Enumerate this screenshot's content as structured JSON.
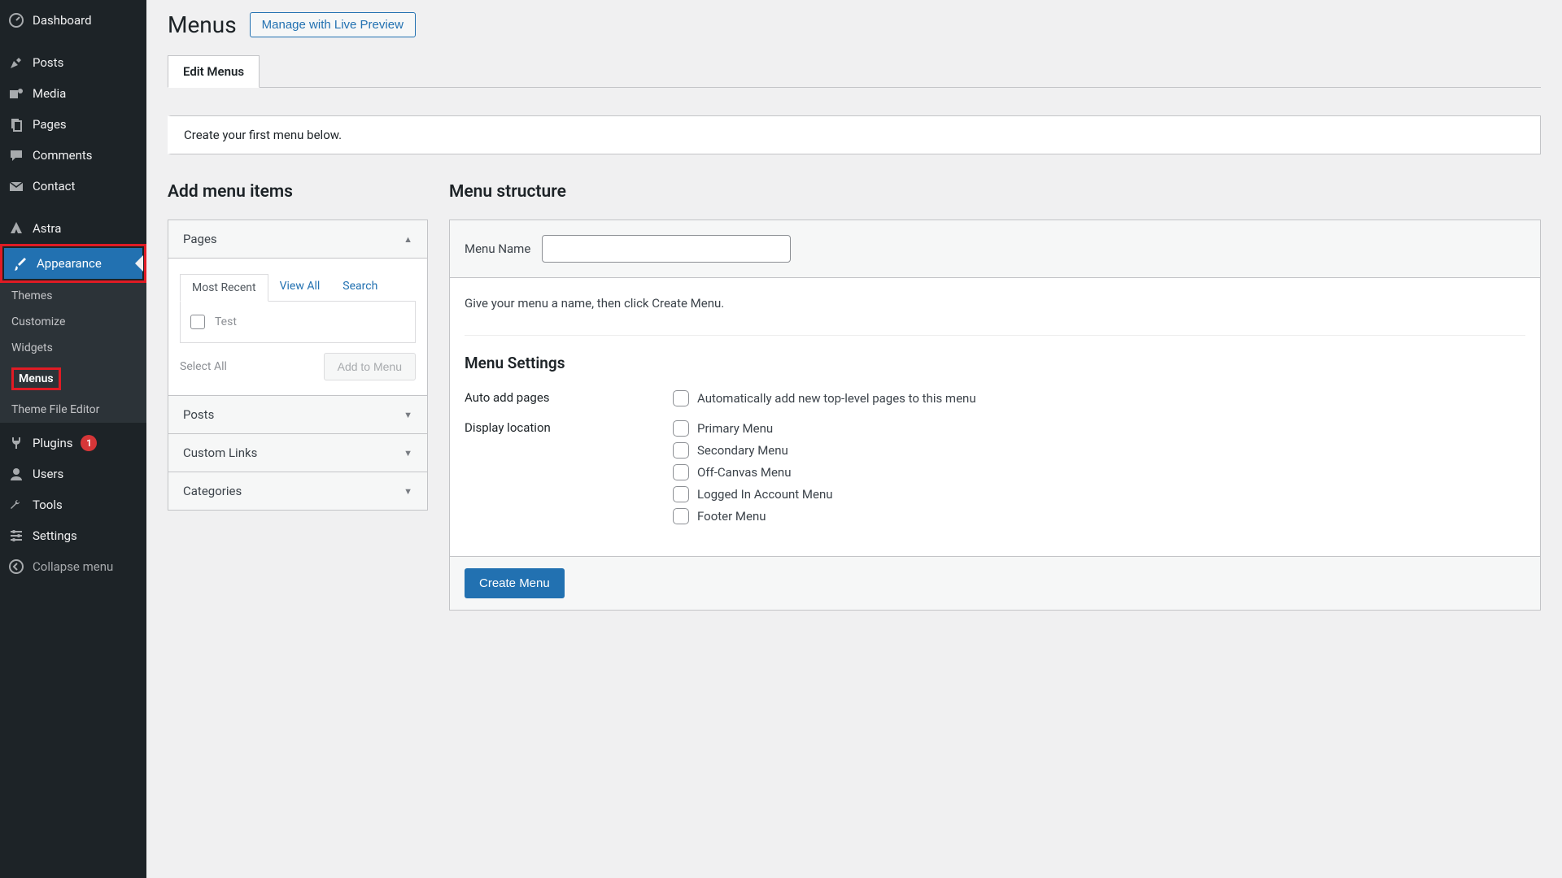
{
  "sidebar": {
    "items": [
      {
        "label": "Dashboard"
      },
      {
        "label": "Posts"
      },
      {
        "label": "Media"
      },
      {
        "label": "Pages"
      },
      {
        "label": "Comments"
      },
      {
        "label": "Contact"
      },
      {
        "label": "Astra"
      },
      {
        "label": "Appearance"
      },
      {
        "label": "Plugins"
      },
      {
        "label": "Users"
      },
      {
        "label": "Tools"
      },
      {
        "label": "Settings"
      }
    ],
    "sub": {
      "themes": "Themes",
      "customize": "Customize",
      "widgets": "Widgets",
      "menus": "Menus",
      "editor": "Theme File Editor"
    },
    "plugins_badge": "1",
    "collapse": "Collapse menu"
  },
  "page": {
    "title": "Menus",
    "live_preview": "Manage with Live Preview",
    "tab": "Edit Menus",
    "notice": "Create your first menu below."
  },
  "left": {
    "heading": "Add menu items",
    "pages": "Pages",
    "posts": "Posts",
    "custom_links": "Custom Links",
    "categories": "Categories",
    "subtabs": {
      "recent": "Most Recent",
      "view_all": "View All",
      "search": "Search"
    },
    "test_item": "Test",
    "select_all": "Select All",
    "add_to_menu": "Add to Menu"
  },
  "right": {
    "heading": "Menu structure",
    "menu_name_label": "Menu Name",
    "hint": "Give your menu a name, then click Create Menu.",
    "settings_title": "Menu Settings",
    "auto_add_label": "Auto add pages",
    "auto_add_option": "Automatically add new top-level pages to this menu",
    "display_label": "Display location",
    "locations": [
      "Primary Menu",
      "Secondary Menu",
      "Off-Canvas Menu",
      "Logged In Account Menu",
      "Footer Menu"
    ],
    "create": "Create Menu"
  }
}
